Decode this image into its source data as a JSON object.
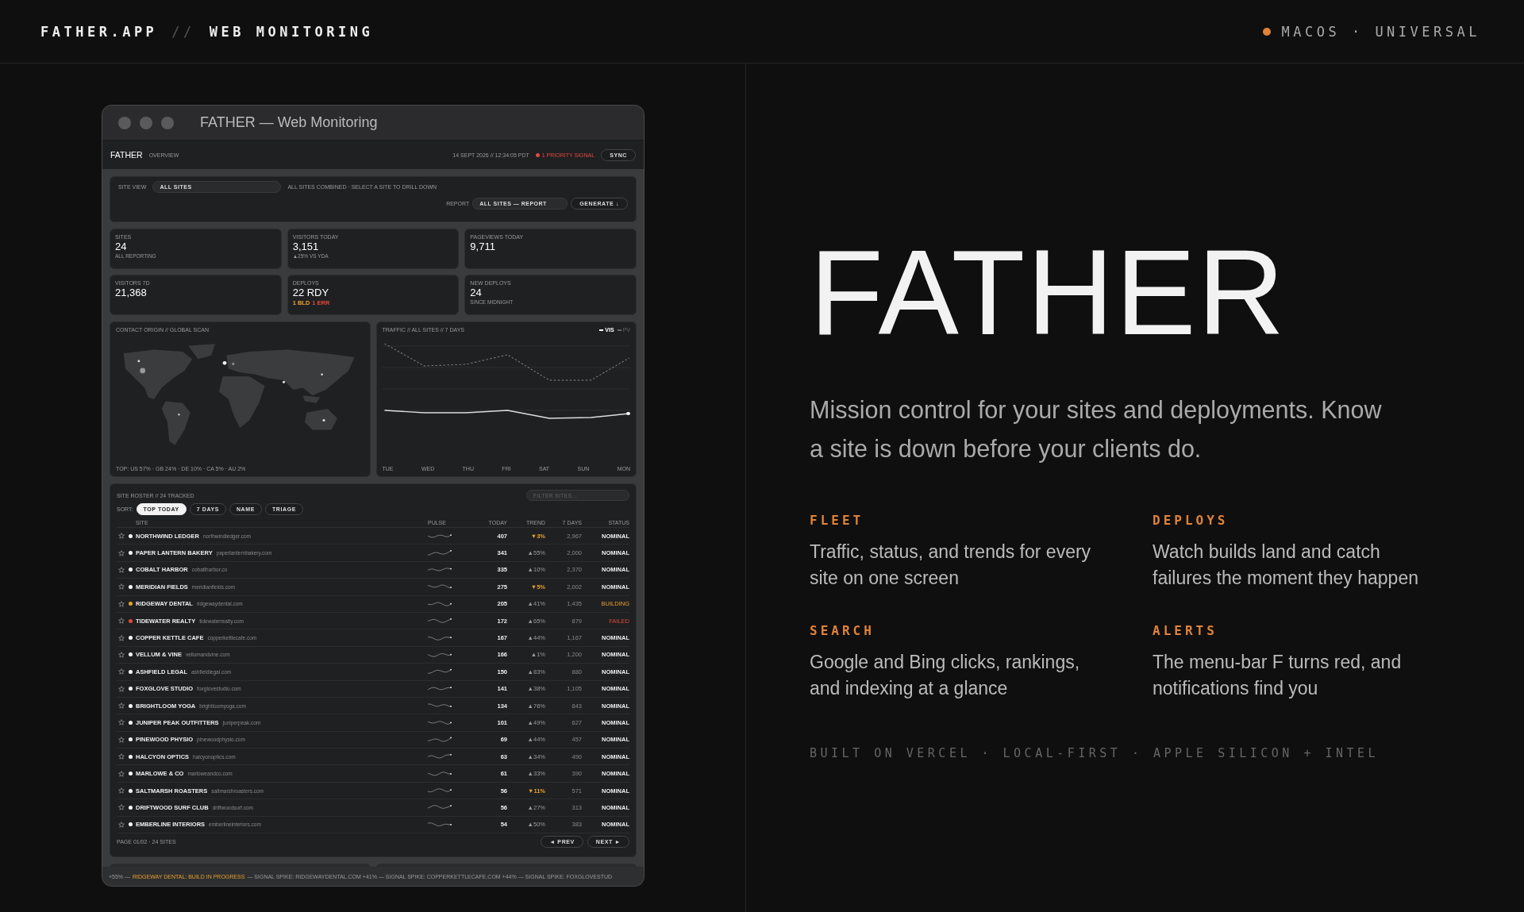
{
  "header": {
    "brand": "FATHER.APP",
    "separator": "//",
    "title": "WEB MONITORING",
    "platform": "MACOS · UNIVERSAL"
  },
  "app": {
    "window_title": "FATHER — Web Monitoring",
    "toolbar": {
      "brand": "FATHER",
      "section": "OVERVIEW",
      "datetime": "14 SEPT 2026 // 12:34:05 PDT",
      "signal": "1 PRIORITY SIGNAL",
      "sync": "SYNC"
    },
    "site_view": {
      "label": "SITE VIEW",
      "value": "ALL SITES",
      "hint": "ALL SITES COMBINED · SELECT A SITE TO DRILL DOWN",
      "report_label": "REPORT",
      "report_value": "ALL SITES — REPORT",
      "generate": "GENERATE ↓"
    },
    "stats": [
      {
        "label": "SITES",
        "value": "24",
        "sub": "ALL REPORTING"
      },
      {
        "label": "VISITORS TODAY",
        "value": "3,151",
        "sub": "▲25% VS YDA"
      },
      {
        "label": "PAGEVIEWS TODAY",
        "value": "9,711"
      },
      {
        "label": "VISITORS 7D",
        "value": "21,368"
      },
      {
        "label": "DEPLOYS",
        "value": "22 RDY",
        "flags": [
          {
            "text": "1 BLD",
            "color": "#e8a030"
          },
          {
            "text": "1 ERR",
            "color": "#e5483a"
          }
        ]
      },
      {
        "label": "NEW DEPLOYS",
        "value": "24",
        "sub": "SINCE MIDNIGHT"
      }
    ],
    "map": {
      "title": "CONTACT ORIGIN // GLOBAL SCAN",
      "summary": "TOP: US 57% · GB 24% · DE 10% · CA 5% · AU 2%"
    },
    "traffic": {
      "title": "TRAFFIC // ALL SITES // 7 DAYS",
      "legend": [
        {
          "label": "VIS",
          "selected": true
        },
        {
          "label": "PV",
          "selected": false
        }
      ],
      "days": [
        "TUE",
        "WED",
        "THU",
        "FRI",
        "SAT",
        "SUN",
        "MON"
      ]
    },
    "roster": {
      "title": "SITE ROSTER // 24 TRACKED",
      "filter_placeholder": "FILTER SITES...",
      "sort_label": "SORT:",
      "sort_options": [
        {
          "label": "TOP TODAY",
          "selected": true
        },
        {
          "label": "7 DAYS",
          "selected": false
        },
        {
          "label": "NAME",
          "selected": false
        },
        {
          "label": "TRIAGE",
          "selected": false
        }
      ],
      "columns": [
        "SITE",
        "PULSE",
        "TODAY",
        "TREND",
        "7 DAYS",
        "STATUS"
      ],
      "rows": [
        {
          "name": "NORTHWIND LEDGER",
          "domain": "northwindledger.com",
          "today": "407",
          "trend": "▼3%",
          "trend_falling": true,
          "days7": "2,967",
          "status": "NOMINAL",
          "building": false,
          "failed": false,
          "color": "#ffffff",
          "starred": false
        },
        {
          "name": "PAPER LANTERN BAKERY",
          "domain": "paperlanternbakery.com",
          "today": "341",
          "trend": "▲55%",
          "trend_falling": false,
          "days7": "2,000",
          "status": "NOMINAL",
          "building": false,
          "failed": false,
          "color": "#ffffff",
          "starred": false
        },
        {
          "name": "COBALT HARBOR",
          "domain": "cobaltharbor.co",
          "today": "335",
          "trend": "▲10%",
          "trend_falling": false,
          "days7": "2,370",
          "status": "NOMINAL",
          "building": false,
          "failed": false,
          "color": "#ffffff",
          "starred": false
        },
        {
          "name": "MERIDIAN FIELDS",
          "domain": "meridianfields.com",
          "today": "275",
          "trend": "▼5%",
          "trend_falling": true,
          "days7": "2,002",
          "status": "NOMINAL",
          "building": false,
          "failed": false,
          "color": "#ffffff",
          "starred": false
        },
        {
          "name": "RIDGEWAY DENTAL",
          "domain": "ridgewaydental.com",
          "today": "205",
          "trend": "▲41%",
          "trend_falling": false,
          "days7": "1,435",
          "status": "BUILDING",
          "building": true,
          "failed": false,
          "color": "#e8a030",
          "starred": false
        },
        {
          "name": "TIDEWATER REALTY",
          "domain": "tidewaterrealty.com",
          "today": "172",
          "trend": "▲65%",
          "trend_falling": false,
          "days7": "879",
          "status": "FAILED",
          "building": false,
          "failed": true,
          "color": "#e5483a",
          "starred": false
        },
        {
          "name": "COPPER KETTLE CAFE",
          "domain": "copperkettlecafe.com",
          "today": "167",
          "trend": "▲44%",
          "trend_falling": false,
          "days7": "1,167",
          "status": "NOMINAL",
          "building": false,
          "failed": false,
          "color": "#ffffff",
          "starred": false
        },
        {
          "name": "VELLUM & VINE",
          "domain": "vellumandvine.com",
          "today": "166",
          "trend": "▲1%",
          "trend_falling": false,
          "days7": "1,200",
          "status": "NOMINAL",
          "building": false,
          "failed": false,
          "color": "#ffffff",
          "starred": false
        },
        {
          "name": "ASHFIELD LEGAL",
          "domain": "ashfieldlegal.com",
          "today": "150",
          "trend": "▲83%",
          "trend_falling": false,
          "days7": "880",
          "status": "NOMINAL",
          "building": false,
          "failed": false,
          "color": "#ffffff",
          "starred": false
        },
        {
          "name": "FOXGLOVE STUDIO",
          "domain": "foxglovestudio.com",
          "today": "141",
          "trend": "▲38%",
          "trend_falling": false,
          "days7": "1,105",
          "status": "NOMINAL",
          "building": false,
          "failed": false,
          "color": "#ffffff",
          "starred": false
        },
        {
          "name": "BRIGHTLOOM YOGA",
          "domain": "brightloomyoga.com",
          "today": "134",
          "trend": "▲76%",
          "trend_falling": false,
          "days7": "843",
          "status": "NOMINAL",
          "building": false,
          "failed": false,
          "color": "#ffffff",
          "starred": false
        },
        {
          "name": "JUNIPER PEAK OUTFITTERS",
          "domain": "juniperpeak.com",
          "today": "101",
          "trend": "▲49%",
          "trend_falling": false,
          "days7": "627",
          "status": "NOMINAL",
          "building": false,
          "failed": false,
          "color": "#ffffff",
          "starred": false
        },
        {
          "name": "PINEWOOD PHYSIO",
          "domain": "pinewoodphysio.com",
          "today": "69",
          "trend": "▲44%",
          "trend_falling": false,
          "days7": "457",
          "status": "NOMINAL",
          "building": false,
          "failed": false,
          "color": "#ffffff",
          "starred": false
        },
        {
          "name": "HALCYON OPTICS",
          "domain": "halcyonoptics.com",
          "today": "63",
          "trend": "▲34%",
          "trend_falling": false,
          "days7": "490",
          "status": "NOMINAL",
          "building": false,
          "failed": false,
          "color": "#ffffff",
          "starred": false
        },
        {
          "name": "MARLOWE & CO",
          "domain": "marloweandco.com",
          "today": "61",
          "trend": "▲33%",
          "trend_falling": false,
          "days7": "390",
          "status": "NOMINAL",
          "building": false,
          "failed": false,
          "color": "#ffffff",
          "starred": false
        },
        {
          "name": "SALTMARSH ROASTERS",
          "domain": "saltmarshroasters.com",
          "today": "56",
          "trend": "▼11%",
          "trend_falling": true,
          "days7": "571",
          "status": "NOMINAL",
          "building": false,
          "failed": false,
          "color": "#ffffff",
          "starred": false
        },
        {
          "name": "DRIFTWOOD SURF CLUB",
          "domain": "driftwoodsurf.com",
          "today": "56",
          "trend": "▲27%",
          "trend_falling": false,
          "days7": "313",
          "status": "NOMINAL",
          "building": false,
          "failed": false,
          "color": "#ffffff",
          "starred": false
        },
        {
          "name": "EMBERLINE INTERIORS",
          "domain": "emberlineinteriors.com",
          "today": "54",
          "trend": "▲50%",
          "trend_falling": false,
          "days7": "383",
          "status": "NOMINAL",
          "building": false,
          "failed": false,
          "color": "#ffffff",
          "starred": false
        }
      ],
      "page_info": "PAGE 01/02 · 24 SITES",
      "prev": "◄ PREV",
      "next": "NEXT ►"
    },
    "ticker": [
      {
        "text": "+55% —",
        "alert": false
      },
      {
        "text": "RIDGEWAY DENTAL: BUILD IN PROGRESS",
        "alert": true
      },
      {
        "text": "— SIGNAL SPIKE: RIDGEWAYDENTAL.COM +41% — SIGNAL SPIKE: COPPERKETTLECAFE.COM +44% — SIGNAL SPIKE: FOXGLOVESTUD",
        "alert": false
      }
    ]
  },
  "hero": {
    "title": "FATHER",
    "tagline": "Mission control for your sites and deployments. Know a site is down before your clients do.",
    "features": [
      {
        "label": "FLEET",
        "text": "Traffic, status, and trends for every site on one screen"
      },
      {
        "label": "DEPLOYS",
        "text": "Watch builds land and catch failures the moment they happen"
      },
      {
        "label": "SEARCH",
        "text": "Google and Bing clicks, rankings, and indexing at a glance"
      },
      {
        "label": "ALERTS",
        "text": "The menu-bar F turns red, and notifications find you"
      }
    ],
    "footnote": "BUILT ON VERCEL · LOCAL-FIRST · APPLE SILICON + INTEL"
  }
}
